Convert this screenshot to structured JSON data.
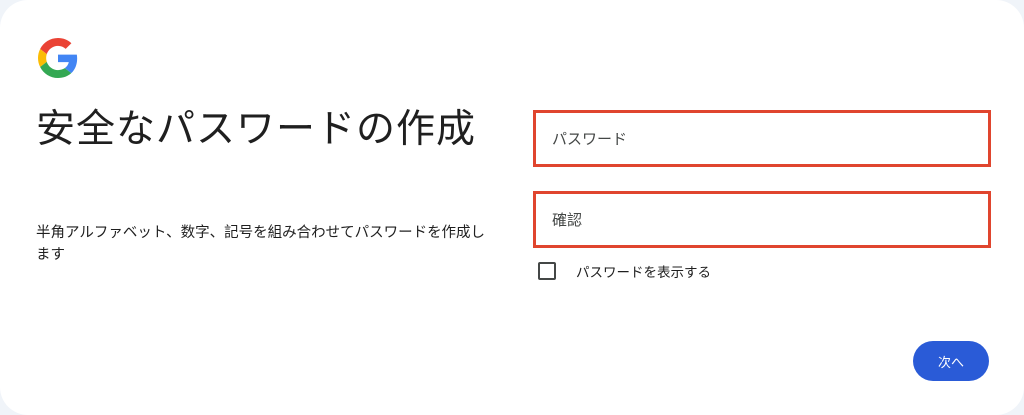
{
  "brand": {
    "logo_icon": "google-g-logo-icon",
    "colors": {
      "blue": "#4285F4",
      "red": "#EA4335",
      "yellow": "#FBBC05",
      "green": "#34A853"
    }
  },
  "heading": {
    "title": "安全なパスワードの作成",
    "subtitle": "半角アルファベット、数字、記号を組み合わせてパスワードを作成します"
  },
  "form": {
    "password_placeholder": "パスワード",
    "password_value": "",
    "confirm_placeholder": "確認",
    "confirm_value": "",
    "show_password_label": "パスワードを表示する",
    "show_password_checked": false,
    "highlight_color": "#e0452e"
  },
  "actions": {
    "next_label": "次へ",
    "next_color": "#2a5bd7"
  }
}
